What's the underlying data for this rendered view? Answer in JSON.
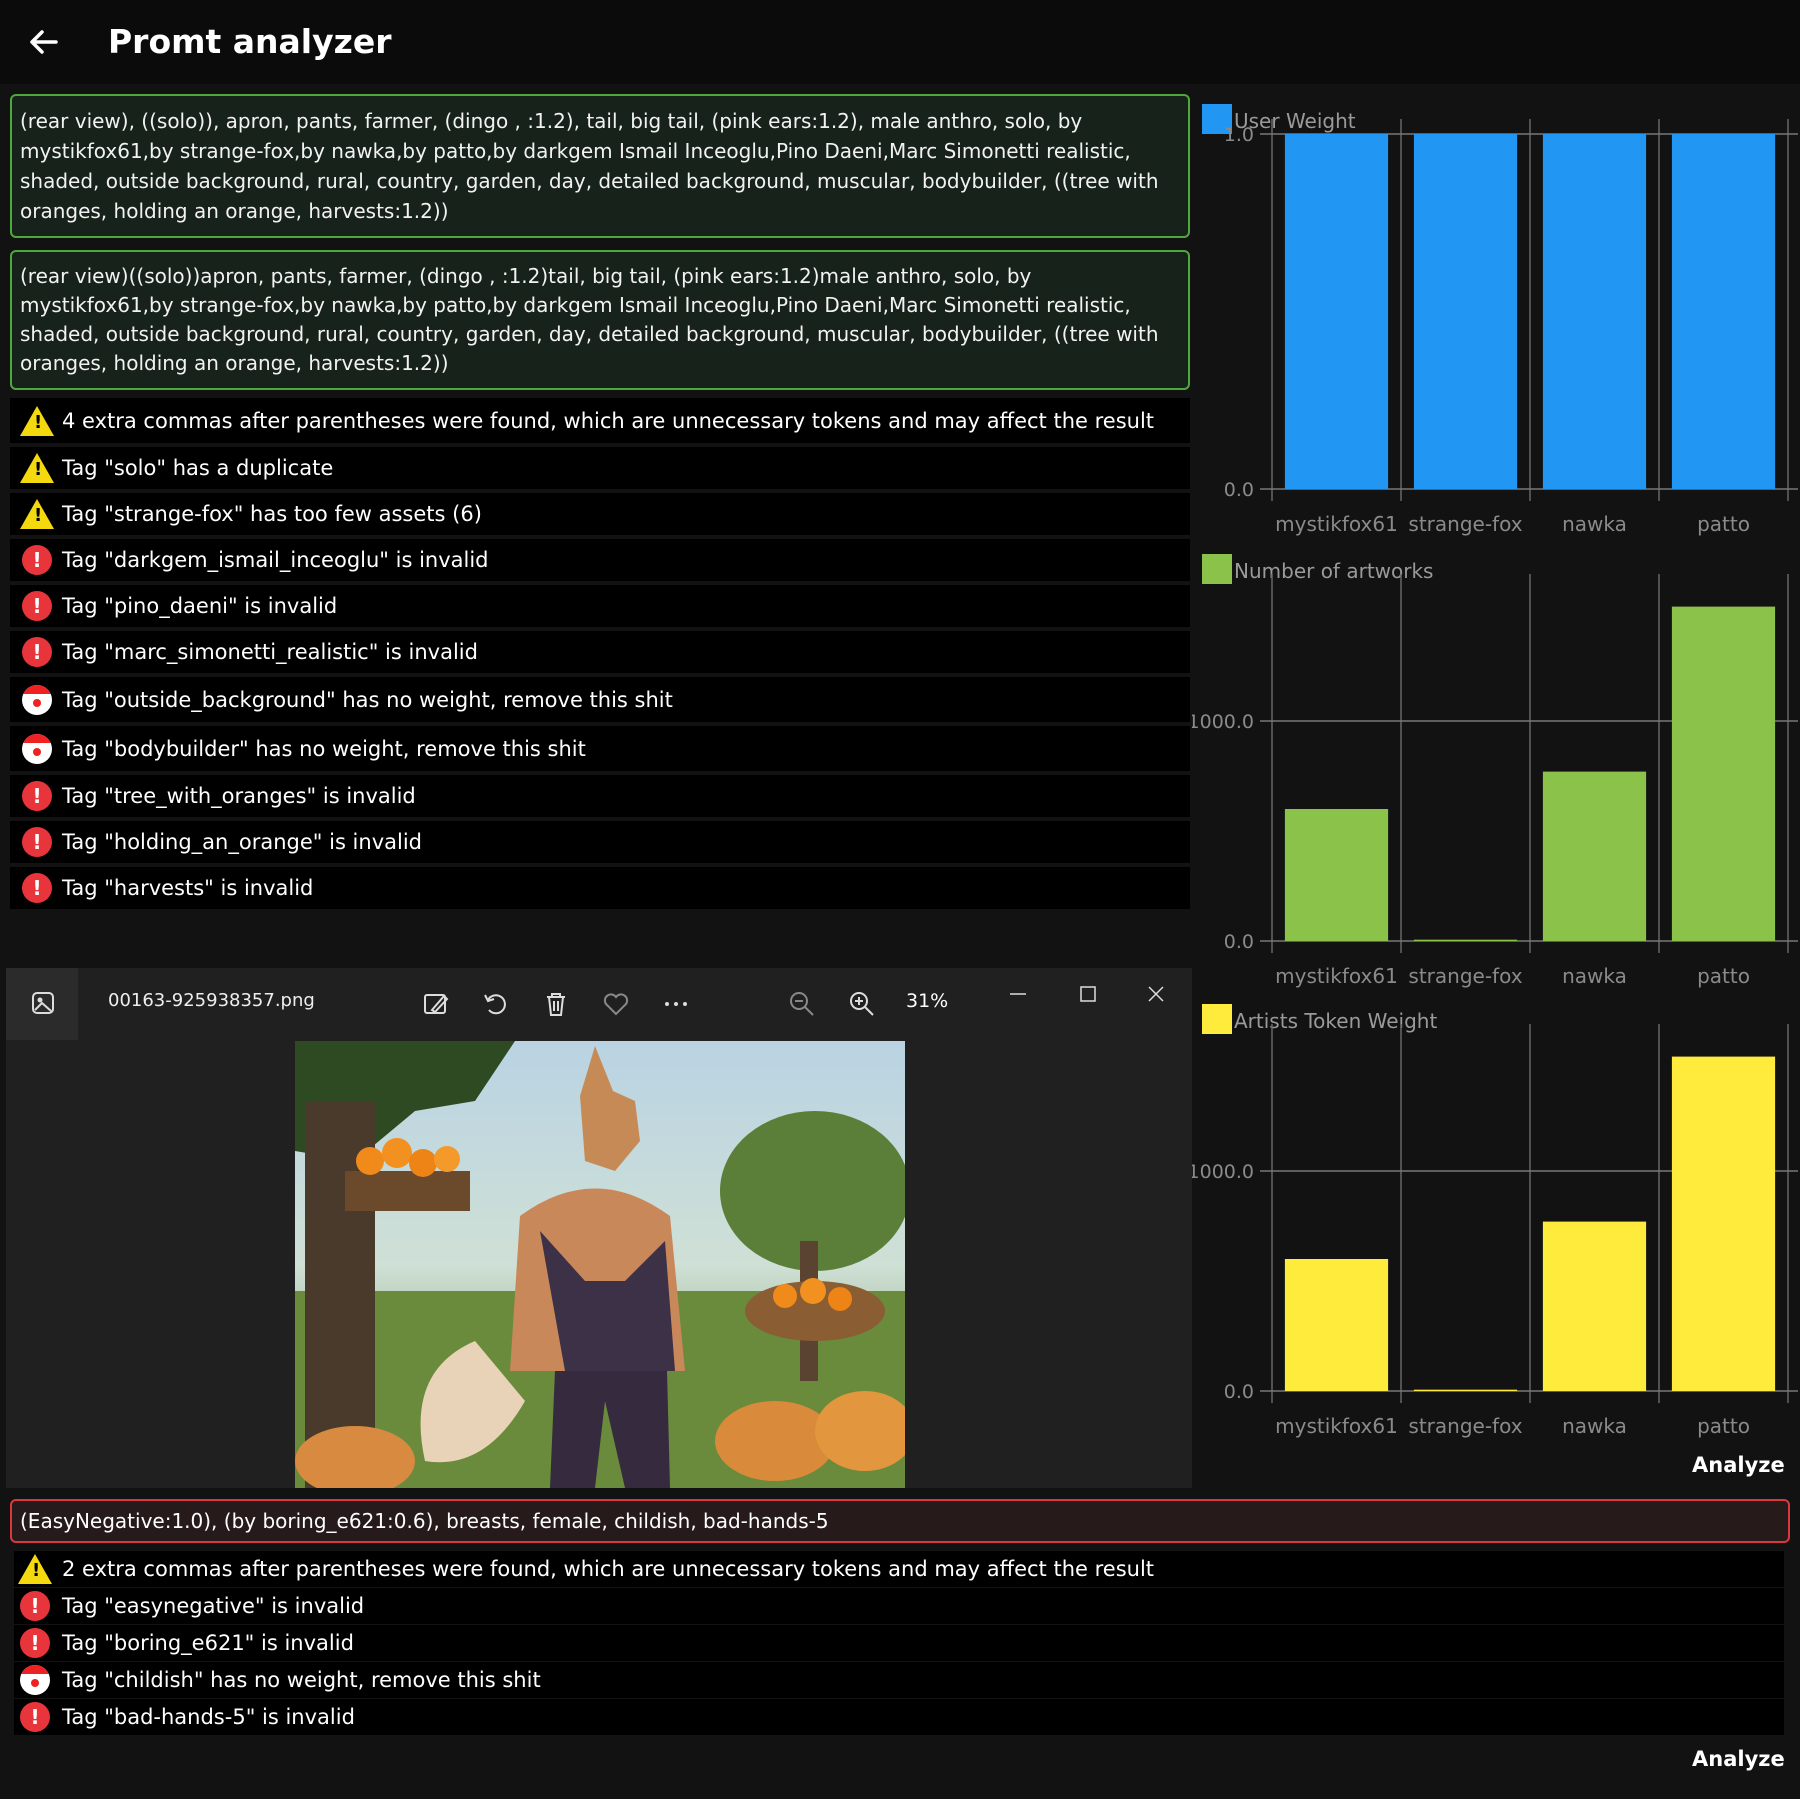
{
  "app": {
    "title": "Promt analyzer"
  },
  "prompt": {
    "original": "(rear view), ((solo)), apron, pants, farmer, (dingo , :1.2), tail, big tail, (pink ears:1.2), male anthro, solo, by mystikfox61,by strange-fox,by nawka,by patto,by darkgem Ismail Inceoglu,Pino Daeni,Marc Simonetti realistic, shaded, outside background, rural, country, garden, day, detailed background, muscular, bodybuilder, ((tree with oranges, holding an orange, harvests:1.2))",
    "cleaned": "(rear view)((solo))apron, pants, farmer, (dingo , :1.2)tail, big tail, (pink ears:1.2)male anthro, solo, by mystikfox61,by strange-fox,by nawka,by patto,by darkgem Ismail Inceoglu,Pino Daeni,Marc Simonetti realistic, shaded, outside background, rural, country, garden, day, detailed background, muscular, bodybuilder, ((tree with oranges, holding an orange, harvests:1.2))"
  },
  "messages": [
    {
      "type": "warning",
      "text": "4 extra commas after parentheses were found, which are unnecessary tokens and may affect the result"
    },
    {
      "type": "warning",
      "text": "Tag \"solo\" has a duplicate"
    },
    {
      "type": "warning",
      "text": "Tag \"strange-fox\" has too few assets (6)"
    },
    {
      "type": "error",
      "text": "Tag \"darkgem_ismail_inceoglu\" is invalid"
    },
    {
      "type": "error",
      "text": "Tag \"pino_daeni\" is invalid"
    },
    {
      "type": "error",
      "text": "Tag \"marc_simonetti_realistic\" is invalid"
    },
    {
      "type": "clown",
      "text": "Tag \"outside_background\" has no weight, remove this shit"
    },
    {
      "type": "clown",
      "text": "Tag \"bodybuilder\" has no weight, remove this shit"
    },
    {
      "type": "error",
      "text": "Tag \"tree_with_oranges\" is invalid"
    },
    {
      "type": "error",
      "text": "Tag \"holding_an_orange\" is invalid"
    },
    {
      "type": "error",
      "text": "Tag \"harvests\" is invalid"
    }
  ],
  "viewer": {
    "filename": "00163-925938357.png",
    "zoom": "31%",
    "icons": [
      "image-edit-icon",
      "rotate-icon",
      "delete-icon",
      "favorite-icon",
      "more-icon",
      "zoom-out-icon",
      "zoom-in-icon",
      "minimize-icon",
      "maximize-icon",
      "close-icon"
    ]
  },
  "chart_data": [
    {
      "type": "bar",
      "title": "User Weight",
      "color": "#2196f3",
      "categories": [
        "mystikfox61",
        "strange-fox",
        "nawka",
        "patto"
      ],
      "values": [
        1.0,
        1.0,
        1.0,
        1.0
      ],
      "ylim": [
        0,
        1.0
      ],
      "yticks": [
        "0.0",
        "1.0"
      ]
    },
    {
      "type": "bar",
      "title": "Number of artworks",
      "color": "#8bc34a",
      "categories": [
        "mystikfox61",
        "strange-fox",
        "nawka",
        "patto"
      ],
      "values": [
        600,
        6,
        770,
        1520
      ],
      "ylim": [
        0,
        1600
      ],
      "yticks": [
        "0.0",
        "1000.0"
      ]
    },
    {
      "type": "bar",
      "title": "Artists Token Weight",
      "color": "#ffeb3b",
      "categories": [
        "mystikfox61",
        "strange-fox",
        "nawka",
        "patto"
      ],
      "values": [
        600,
        6,
        770,
        1520
      ],
      "ylim": [
        0,
        1600
      ],
      "yticks": [
        "0.0",
        "1000.0"
      ]
    }
  ],
  "analyze_label": "Analyze",
  "negative": {
    "text": "(EasyNegative:1.0), (by boring_e621:0.6), breasts, female, childish, bad-hands-5",
    "messages": [
      {
        "type": "warning",
        "text": "2 extra commas after parentheses were found, which are unnecessary tokens and may affect the result"
      },
      {
        "type": "error",
        "text": "Tag \"easynegative\" is invalid"
      },
      {
        "type": "error",
        "text": "Tag \"boring_e621\" is invalid"
      },
      {
        "type": "clown",
        "text": "Tag \"childish\" has no weight, remove this shit"
      },
      {
        "type": "error",
        "text": "Tag \"bad-hands-5\" is invalid"
      }
    ]
  },
  "colors": {
    "prompt_border": "#4fa83d",
    "negative_border": "#d9383f",
    "error": "#e8343b",
    "warning": "#f5d90f"
  }
}
